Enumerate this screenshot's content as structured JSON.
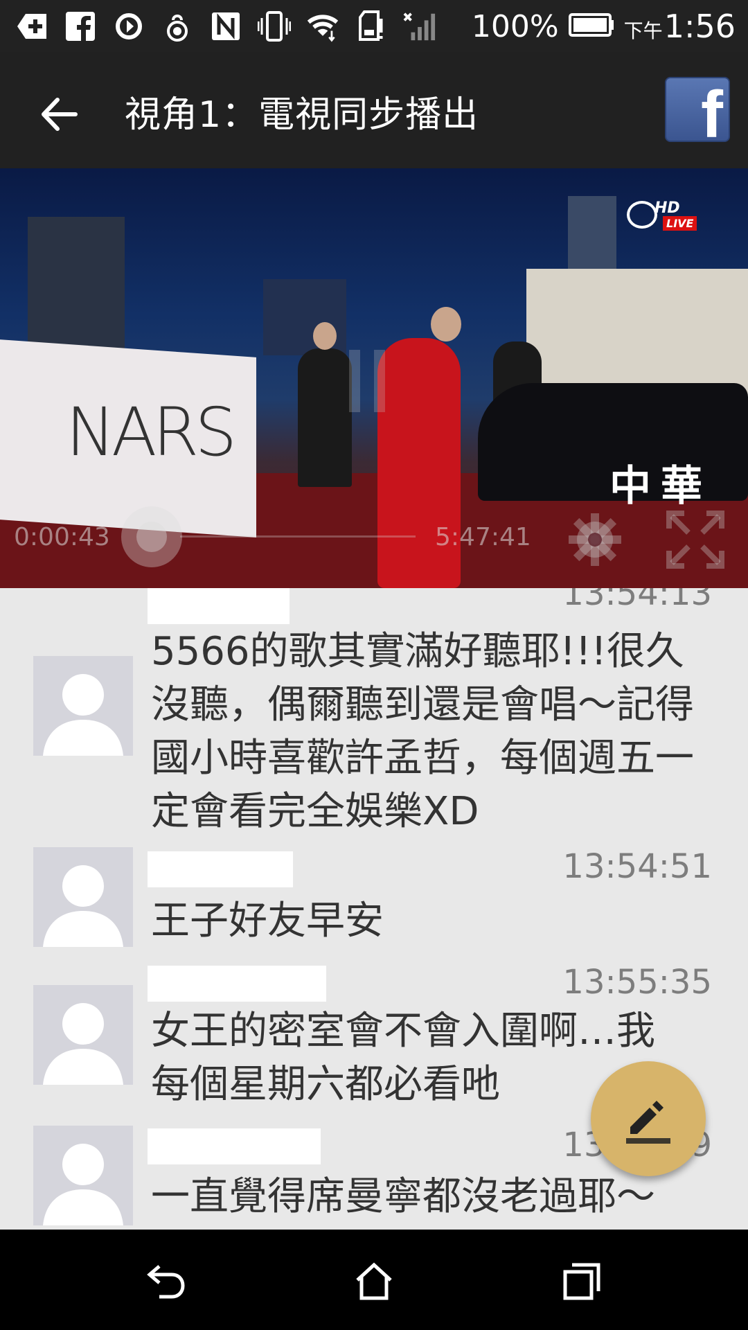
{
  "status_bar": {
    "battery": "100%",
    "time_prefix": "下午",
    "time": "1:56",
    "icons": [
      "plus-box-icon",
      "facebook-icon",
      "sync-icon",
      "hand-icon",
      "nfc-icon",
      "vibrate-icon",
      "wifi-icon",
      "sd-card-icon",
      "no-signal-icon",
      "battery-icon"
    ]
  },
  "app_bar": {
    "title": "視角1：電視同步播出",
    "back_icon": "arrow-back-icon",
    "share_icon": "facebook-icon"
  },
  "video": {
    "current_time": "0:00:43",
    "total_time": "5:47:41",
    "progress": 0.002,
    "channel_logo": {
      "hd": "HD",
      "live": "LIVE"
    },
    "scene_text": {
      "sign": "NARS",
      "car": "中華"
    },
    "controls": [
      "pause-icon",
      "settings-icon",
      "fullscreen-icon"
    ]
  },
  "comments": [
    {
      "time": "13:54:13",
      "text": "5566的歌其實滿好聽耶!!!很久沒聽，偶爾聽到還是會唱～記得國小時喜歡許孟哲，每個週五一定會看完全娛樂XD"
    },
    {
      "time": "13:54:51",
      "text": "王子好友早安"
    },
    {
      "time": "13:55:35",
      "text": "女王的密室會不會入圍啊…我每個星期六都必看吔"
    },
    {
      "time": "13:55:59",
      "text": "一直覺得席曼寧都沒老過耶～"
    }
  ],
  "fab": {
    "icon": "edit-icon"
  },
  "nav_bar": {
    "buttons": [
      "back-icon",
      "home-icon",
      "recents-icon"
    ]
  },
  "colors": {
    "fab": "#d7b46a",
    "app_bar": "#212121",
    "list_bg": "#e8e8e8"
  }
}
